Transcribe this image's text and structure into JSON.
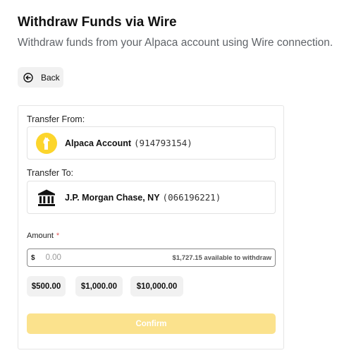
{
  "header": {
    "title": "Withdraw Funds via Wire",
    "subtitle": "Withdraw funds from your Alpaca account using Wire connection."
  },
  "back_button": {
    "label": "Back",
    "icon": "arrow-left-circle-icon"
  },
  "transfer_from": {
    "label": "Transfer From:",
    "icon": "alpaca-logo-icon",
    "account_name": "Alpaca Account",
    "account_number": "(914793154)"
  },
  "transfer_to": {
    "label": "Transfer To:",
    "icon": "bank-icon",
    "account_name": "J.P. Morgan Chase, NY",
    "account_number": "(066196221)"
  },
  "amount": {
    "label": "Amount",
    "required_marker": "*",
    "currency_symbol": "$",
    "placeholder": "0.00",
    "value": "",
    "available_text": "$1,727.15 available to withdraw"
  },
  "presets": [
    "$500.00",
    "$1,000.00",
    "$10,000.00"
  ],
  "confirm_button": {
    "label": "Confirm",
    "enabled": false
  },
  "colors": {
    "brand_yellow": "#fcd52c",
    "confirm_disabled": "#fbe28d",
    "required_red": "#e15757",
    "subtle_bg": "#f1f1f1"
  }
}
